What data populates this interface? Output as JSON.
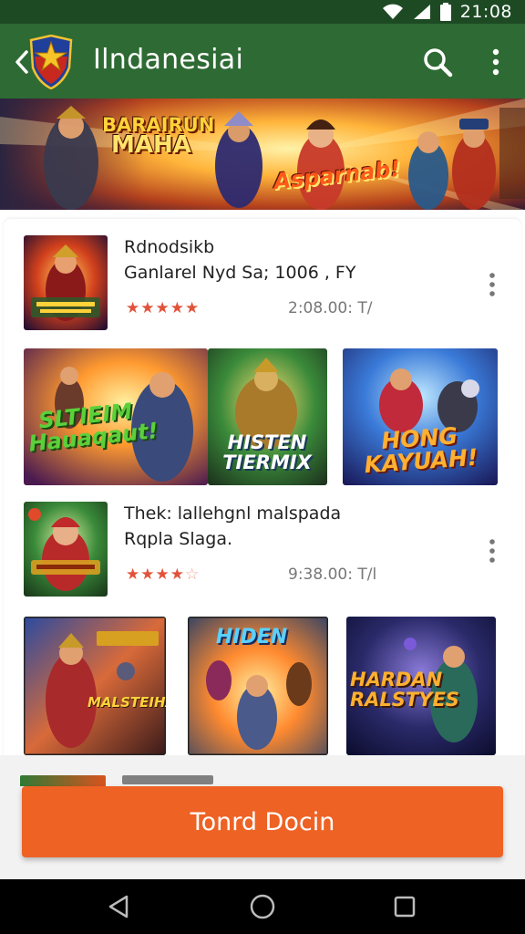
{
  "status_bar": {
    "time": "21:08",
    "icons": [
      "wifi-icon",
      "signal-icon",
      "battery-icon"
    ]
  },
  "app_bar": {
    "title": "Ilndanesiai",
    "icons": [
      "back-arrow-icon",
      "app-shield-logo",
      "search-icon",
      "more-vert-icon"
    ]
  },
  "banner": {
    "title_line1": "BARAIRUN",
    "title_line2": "MAHA",
    "tagline": "Asparnab!"
  },
  "apps": [
    {
      "name": "Rdnodsikb",
      "subtitle": "Ganlarel Nyd Sa; 1006 , FY",
      "rating": 5,
      "stars": "★★★★★",
      "meta": "2:08.00: T/",
      "screenshots": [
        {
          "title": "SLTIEIM Hauaqaut!"
        },
        {
          "title": "HISTEN TIERMIX"
        },
        {
          "title": "HONG KAYUAH!"
        }
      ]
    },
    {
      "name": "Thek: lallehgnl malspada",
      "subtitle": "Rqpla Slaga.",
      "rating": 4,
      "stars": "★★★★",
      "stars_empty": "☆",
      "meta": "9:38.00: T/l",
      "screenshots": [
        {
          "title": "MALSTEIHAN"
        },
        {
          "title": "HIDEN"
        },
        {
          "title": "HARDAN RALSTYES"
        }
      ]
    }
  ],
  "cta": {
    "label": "Tonrd Docin"
  },
  "nav_bar": {
    "icons": [
      "back-triangle-icon",
      "home-circle-icon",
      "recents-square-icon"
    ]
  },
  "colors": {
    "app_bar": "#2e6a33",
    "status_bar": "#1d4a23",
    "cta": "#ee6224",
    "stars": "#e2523a"
  }
}
